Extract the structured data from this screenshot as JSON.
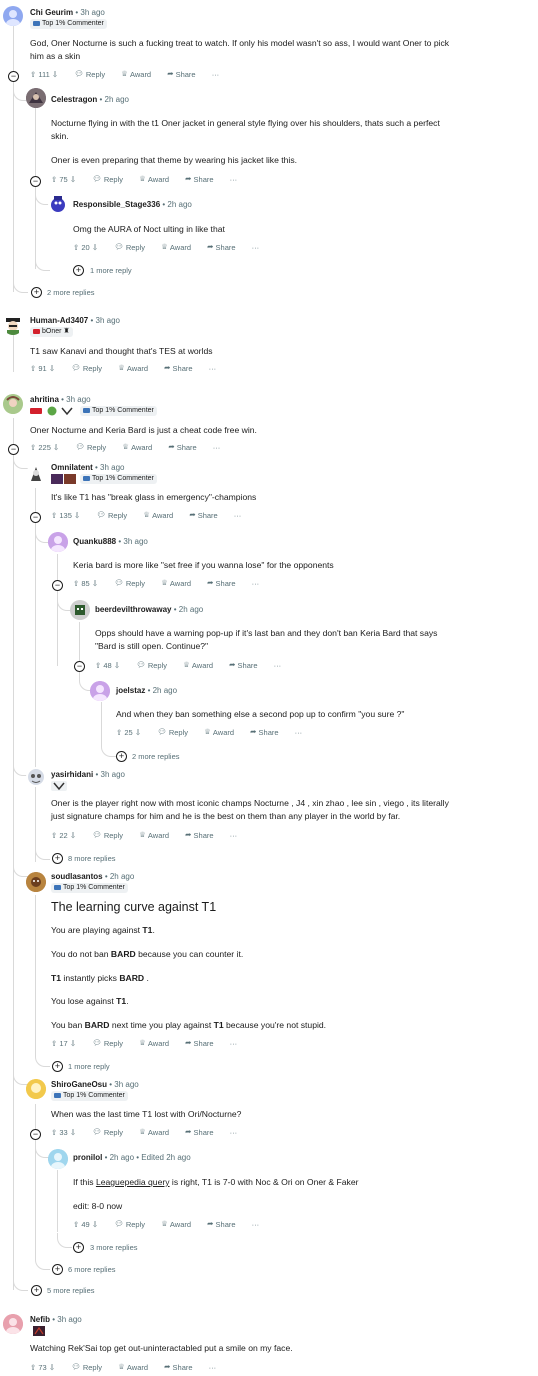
{
  "ui": {
    "reply": "Reply",
    "award": "Award",
    "share": "Share",
    "dots": "···",
    "top1": "Top 1% Commenter"
  },
  "comments": {
    "c1": {
      "author": "Chi Geurim",
      "time": "• 3h ago",
      "lines": [
        "God, Oner Nocturne is such a fucking treat to watch. If only his model wasn't so ass, I would want Oner to pick",
        "him as a skin"
      ],
      "score": "111"
    },
    "c2": {
      "author": "Celestragon",
      "time": "• 2h ago",
      "lines": [
        "Nocturne flying in with the t1 Oner jacket in general style flying over his shoulders, thats such a perfect",
        "skin.",
        "Oner is even preparing that theme by wearing his jacket like this."
      ],
      "score": "75"
    },
    "c3": {
      "author": "Responsible_Stage336",
      "time": "• 2h ago",
      "lines": [
        "Omg the AURA of Noct ulting in like that"
      ],
      "score": "20",
      "more": "1 more reply"
    },
    "c1more": "2 more replies",
    "c4": {
      "author": "Human-Ad3407",
      "time": "• 3h ago",
      "flair": "bOner",
      "lines": [
        "T1 saw Kanavi and thought that's TES at worlds"
      ],
      "score": "91"
    },
    "c5": {
      "author": "ahritina",
      "time": "• 3h ago",
      "lines": [
        "Oner Nocturne and Keria Bard is just a cheat code free win."
      ],
      "score": "225"
    },
    "c6": {
      "author": "Omnilatent",
      "time": "• 3h ago",
      "lines": [
        "It's like T1 has \"break glass in emergency\"-champions"
      ],
      "score": "135"
    },
    "c7": {
      "author": "Quanku888",
      "time": "• 3h ago",
      "lines": [
        "Keria bard is more like \"set free if you wanna lose\" for the opponents"
      ],
      "score": "85"
    },
    "c8": {
      "author": "beerdevilthrowaway",
      "time": "• 2h ago",
      "lines": [
        "Opps should have a warning pop-up if it's last ban and they don't ban Keria Bard that says",
        "\"Bard is still open. Continue?\""
      ],
      "score": "48"
    },
    "c9": {
      "author": "joelstaz",
      "time": "• 2h ago",
      "lines": [
        "And when they ban something else a second pop up to confirm \"you sure ?\""
      ],
      "score": "25"
    },
    "c7more": "2 more replies",
    "c10": {
      "author": "yasirhidani",
      "time": "• 3h ago",
      "lines": [
        "Oner is the player right now with most iconic champs Nocturne , J4 , xin zhao , lee sin , viego , its literally",
        "just signature champs for him and he is the best on them than any player in the world by far."
      ],
      "score": "22",
      "more": "8 more replies"
    },
    "c11": {
      "author": "soudlasantos",
      "time": "• 2h ago",
      "heading": "The learning curve against T1",
      "p1a": "You are playing against ",
      "p1b": "T1",
      "p1c": ".",
      "p2a": "You do not ban ",
      "p2b": "BARD",
      "p2c": " because you can counter it.",
      "p3a": "T1",
      "p3b": " instantly picks ",
      "p3c": "BARD",
      "p3d": " .",
      "p4a": "You lose against ",
      "p4b": "T1",
      "p4c": ".",
      "p5a": "You ban ",
      "p5b": "BARD",
      "p5c": " next time you play against ",
      "p5d": "T1",
      "p5e": " because you're not stupid.",
      "score": "17",
      "more": "1 more reply"
    },
    "c12": {
      "author": "ShiroGaneOsu",
      "time": "• 3h ago",
      "lines": [
        "When was the last time T1 lost with Ori/Nocturne?"
      ],
      "score": "33"
    },
    "c13": {
      "author": "pronilol",
      "time": "• 2h ago • Edited 2h ago",
      "l1a": "If this ",
      "l1b": "Leaguepedia query",
      "l1c": " is right, T1 is 7-0 with Noc & Ori on Oner & Faker",
      "l2": "edit: 8-0 now",
      "score": "49",
      "more": "3 more replies"
    },
    "c12more": "6 more replies",
    "c5more": "5 more replies",
    "c14": {
      "author": "Nefib",
      "time": "• 3h ago",
      "lines": [
        "Watching Rek'Sai top get out-uninteractabled put a smile on my face."
      ],
      "score": "73"
    }
  },
  "colors": {
    "accent": "#3d74b8",
    "line": "#d9d9d9",
    "meta": "#576f76"
  }
}
